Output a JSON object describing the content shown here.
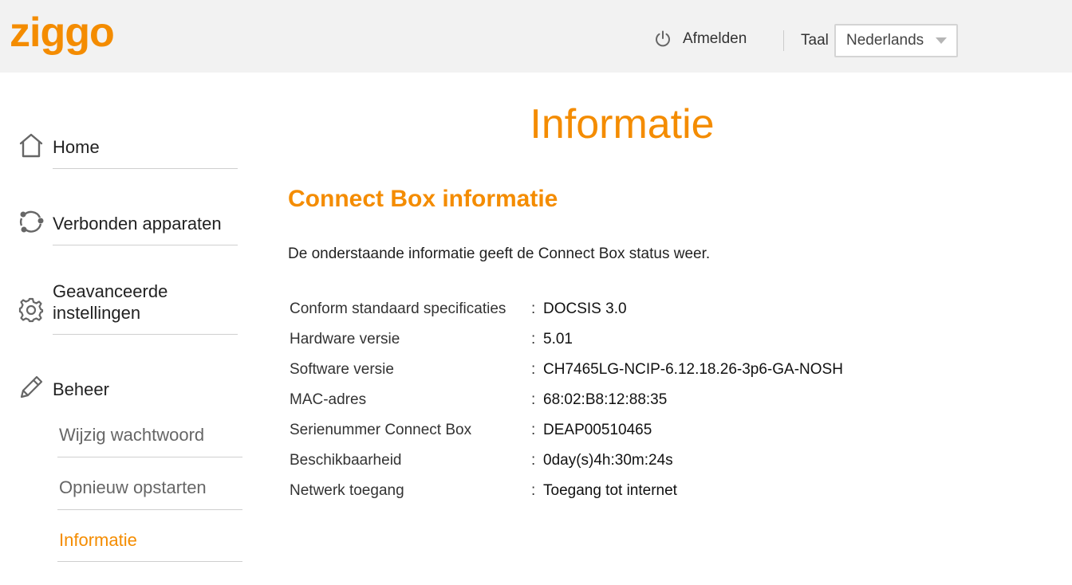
{
  "header": {
    "logo_text": "ziggo",
    "logout_label": "Afmelden",
    "language_label": "Taal",
    "language_value": "Nederlands"
  },
  "sidebar": {
    "items": [
      {
        "label": "Home",
        "icon": "home-icon"
      },
      {
        "label": "Verbonden apparaten",
        "icon": "connected-devices-icon"
      },
      {
        "label": "Geavanceerde instellingen",
        "icon": "gear-icon"
      },
      {
        "label": "Beheer",
        "icon": "pencil-icon"
      }
    ],
    "subitems": [
      {
        "label": "Wijzig wachtwoord"
      },
      {
        "label": "Opnieuw opstarten"
      },
      {
        "label": "Informatie",
        "active": true
      }
    ]
  },
  "main": {
    "title": "Informatie",
    "section_title": "Connect Box informatie",
    "intro": "De onderstaande informatie geeft de Connect Box status weer.",
    "info_rows": [
      {
        "key": "Conform standaard specificaties",
        "value": "DOCSIS 3.0"
      },
      {
        "key": "Hardware versie",
        "value": "5.01"
      },
      {
        "key": "Software versie",
        "value": "CH7465LG-NCIP-6.12.18.26-3p6-GA-NOSH"
      },
      {
        "key": "MAC-adres",
        "value": "68:02:B8:12:88:35"
      },
      {
        "key": "Serienummer Connect Box",
        "value": "DEAP00510465"
      },
      {
        "key": "Beschikbaarheid",
        "value": "0day(s)4h:30m:24s"
      },
      {
        "key": "Netwerk toegang",
        "value": "Toegang tot internet"
      }
    ],
    "separator": ":"
  },
  "colors": {
    "accent": "#f48c00",
    "header_bg": "#f2f2f2"
  }
}
